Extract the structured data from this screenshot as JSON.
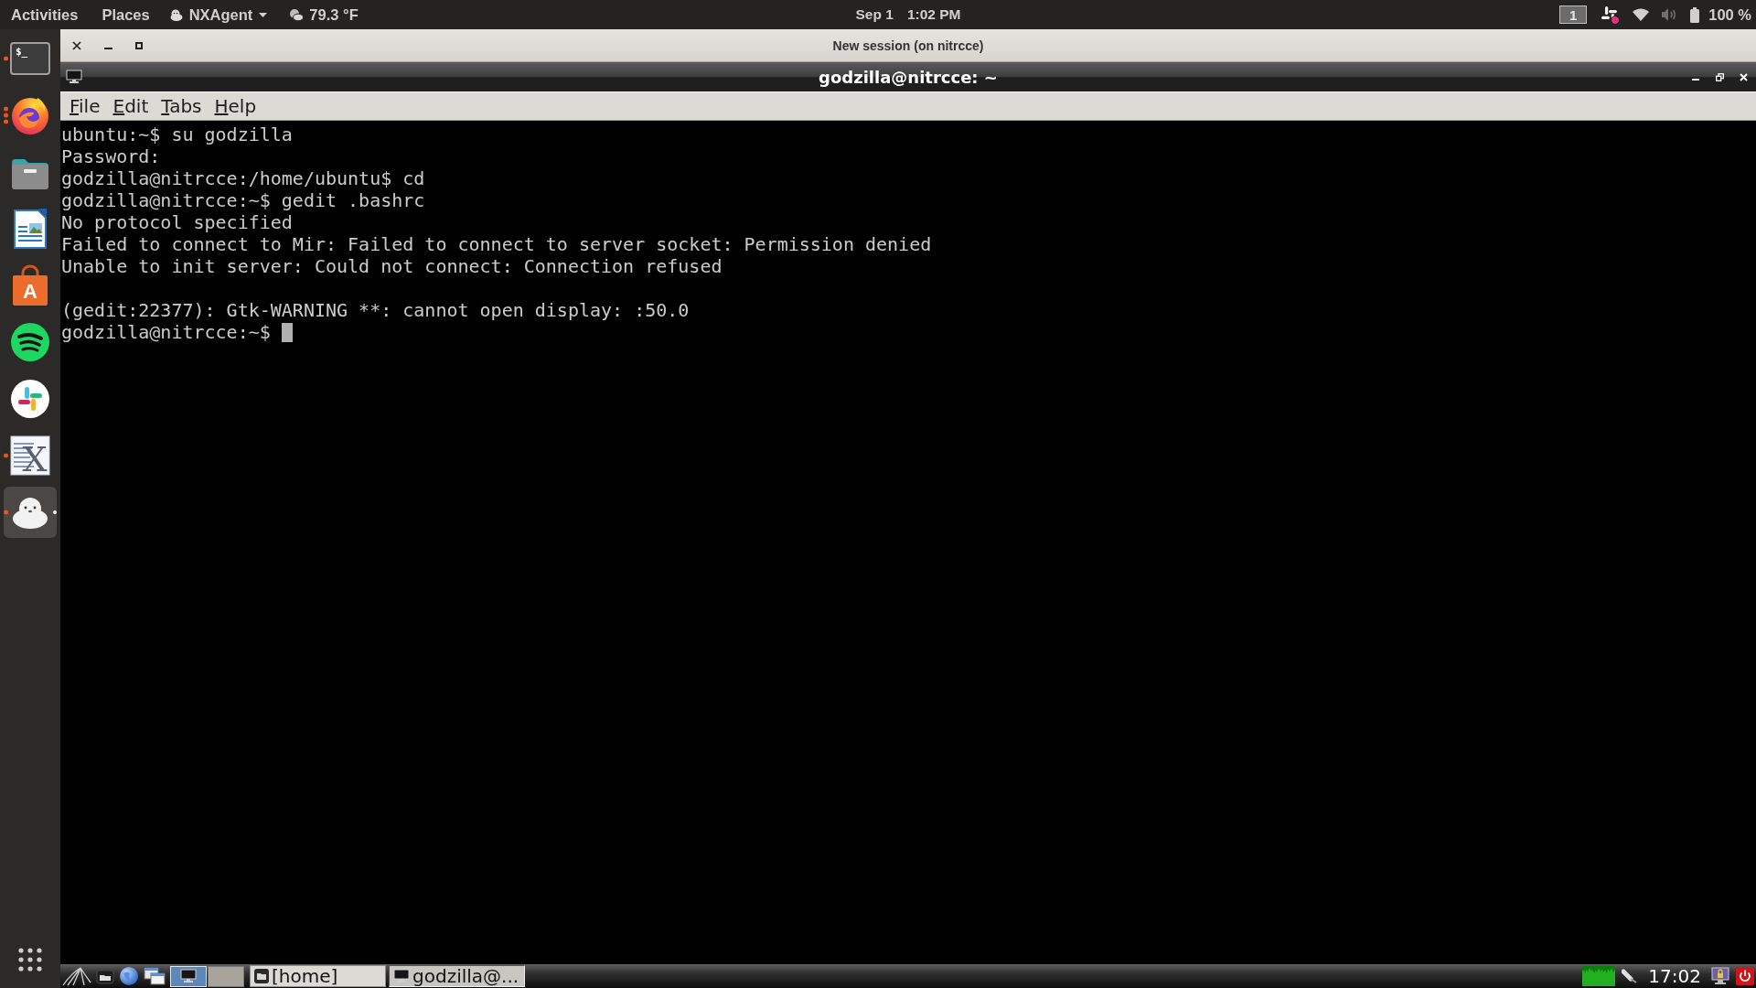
{
  "top_bar": {
    "activities": "Activities",
    "places": "Places",
    "app_menu": "NXAgent",
    "weather": "79.3 °F",
    "date": "Sep 1",
    "time": "1:02 PM",
    "workspace": "1",
    "battery": "100 %"
  },
  "dock": {
    "items": [
      {
        "selected": false,
        "running": true,
        "several_windows": false,
        "glyph": "$_"
      },
      {
        "selected": false,
        "running": true,
        "several_windows": true
      },
      {
        "selected": false,
        "running": false,
        "several_windows": false
      },
      {
        "selected": false,
        "running": false,
        "several_windows": false
      },
      {
        "selected": false,
        "running": false,
        "several_windows": false,
        "glyph": "A"
      },
      {
        "selected": false,
        "running": false,
        "several_windows": false
      },
      {
        "selected": false,
        "running": false,
        "several_windows": false
      },
      {
        "selected": false,
        "running": true,
        "several_windows": false,
        "glyph": "X"
      },
      {
        "selected": true,
        "running": true,
        "several_windows": false
      }
    ]
  },
  "session_window": {
    "title": "New session (on nitrcce)"
  },
  "terminal_window": {
    "title": "godzilla@nitrcce: ~",
    "menu": [
      "File",
      "Edit",
      "Tabs",
      "Help"
    ],
    "blocks": [
      [
        "ubuntu:~$ su godzilla",
        "Password:",
        "godzilla@nitrcce:/home/ubuntu$ cd",
        "godzilla@nitrcce:~$ gedit .bashrc",
        "No protocol specified",
        "Failed to connect to Mir: Failed to connect to server socket: Permission denied",
        "Unable to init server: Could not connect: Connection refused"
      ],
      [
        "(gedit:22377): Gtk-WARNING **: cannot open display: :50.0"
      ]
    ],
    "prompt": "godzilla@nitrcce:~$"
  },
  "taskbar": {
    "desktops": [
      {
        "selected": true
      },
      {
        "selected": false
      }
    ],
    "tasks": [
      {
        "label": "[home]",
        "selected": false
      },
      {
        "label": "godzilla@...",
        "selected": true
      }
    ],
    "clock": "17:02"
  }
}
